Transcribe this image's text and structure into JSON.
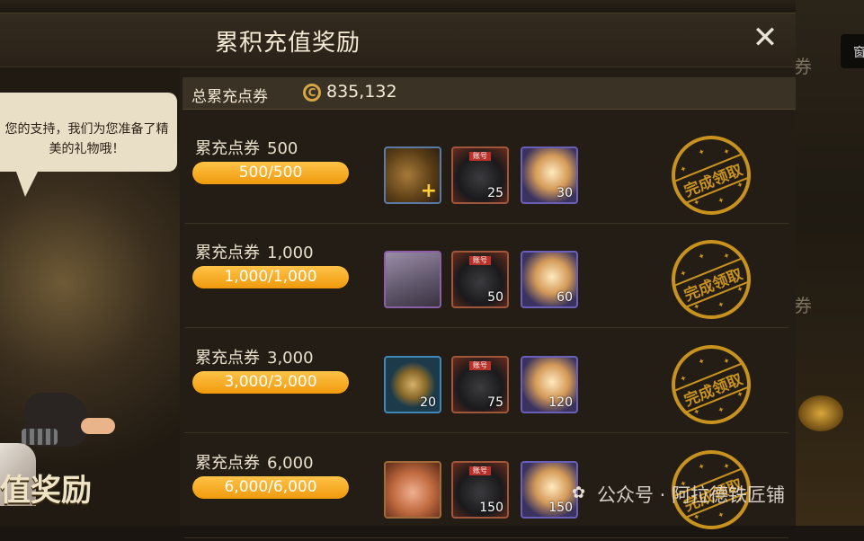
{
  "window": {
    "title": "累积充值奖励"
  },
  "total": {
    "label": "总累充点券",
    "value": "835,132"
  },
  "npc": {
    "speech": "您的支持，我们为您准备了精美的礼物哦！",
    "banner": "值奖励"
  },
  "background": {
    "side_text_1": "券",
    "side_text_2": "券",
    "side_button_text": "窗"
  },
  "tiers": [
    {
      "label": "累充点券",
      "amount": "500",
      "progress": "500/500",
      "progress_fraction": 1.0,
      "rewards": [
        {
          "icon": "bag-plus-icon",
          "qty": ""
        },
        {
          "icon": "ore-icon",
          "tag": "账号",
          "qty": "25"
        },
        {
          "icon": "hand-icon",
          "qty": "30"
        }
      ],
      "status": "完成领取"
    },
    {
      "label": "累充点券",
      "amount": "1,000",
      "progress": "1,000/1,000",
      "progress_fraction": 1.0,
      "rewards": [
        {
          "icon": "chest-icon",
          "qty": ""
        },
        {
          "icon": "ore-icon",
          "tag": "账号",
          "qty": "50"
        },
        {
          "icon": "hand-icon",
          "qty": "60"
        }
      ],
      "status": "完成领取"
    },
    {
      "label": "累充点券",
      "amount": "3,000",
      "progress": "3,000/3,000",
      "progress_fraction": 1.0,
      "rewards": [
        {
          "icon": "medal-icon",
          "qty": "20"
        },
        {
          "icon": "ore-icon",
          "tag": "账号",
          "qty": "75"
        },
        {
          "icon": "hand-icon",
          "qty": "120"
        }
      ],
      "status": "完成领取"
    },
    {
      "label": "累充点券",
      "amount": "6,000",
      "progress": "6,000/6,000",
      "progress_fraction": 1.0,
      "rewards": [
        {
          "icon": "pig-icon",
          "qty": ""
        },
        {
          "icon": "ore-icon",
          "tag": "账号",
          "qty": "150"
        },
        {
          "icon": "hand-icon",
          "qty": "150"
        }
      ],
      "status": "完成领取"
    }
  ],
  "watermark": "公众号 · 阿拉德铁匠铺",
  "colors": {
    "progress_fill": "#f4a51c",
    "stamp": "#c8921e",
    "panel": "#231d15"
  }
}
